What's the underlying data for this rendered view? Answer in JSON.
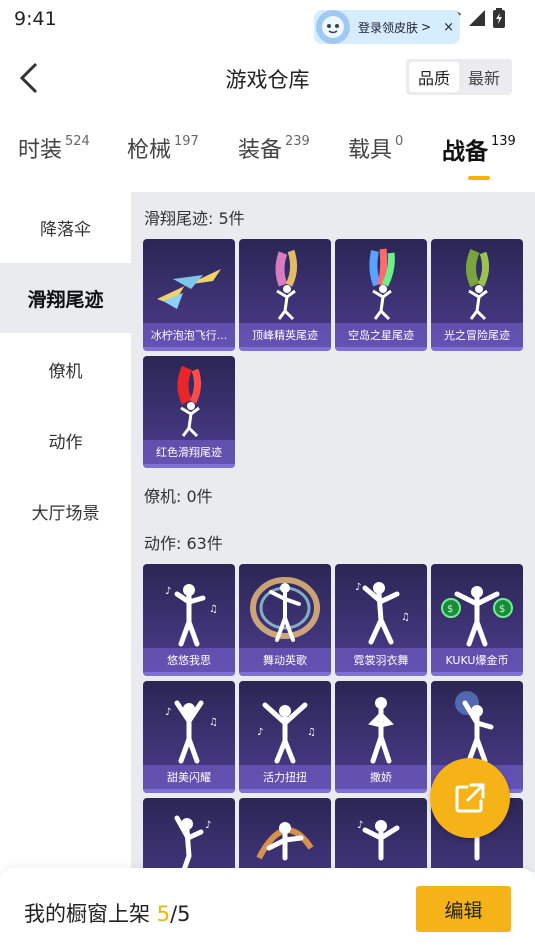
{
  "status": {
    "time": "9:41"
  },
  "promo": {
    "text": "登录领皮肤",
    "arrow": ">",
    "close": "×"
  },
  "header": {
    "title": "游戏仓库",
    "sort_quality": "品质",
    "sort_latest": "最新"
  },
  "tabs": [
    {
      "label": "时装",
      "count": "524"
    },
    {
      "label": "枪械",
      "count": "197"
    },
    {
      "label": "装备",
      "count": "239"
    },
    {
      "label": "载具",
      "count": "0"
    },
    {
      "label": "战备",
      "count": "139"
    }
  ],
  "sidebar": [
    {
      "label": "降落伞"
    },
    {
      "label": "滑翔尾迹"
    },
    {
      "label": "僚机"
    },
    {
      "label": "动作"
    },
    {
      "label": "大厅场景"
    }
  ],
  "sections": {
    "trails": {
      "title": "滑翔尾迹: 5件",
      "items": [
        {
          "label": "冰柠泡泡飞行..."
        },
        {
          "label": "顶峰精英尾迹"
        },
        {
          "label": "空岛之星尾迹"
        },
        {
          "label": "光之冒险尾迹"
        },
        {
          "label": "红色滑翔尾迹"
        }
      ]
    },
    "wingman": {
      "title": "僚机: 0件"
    },
    "actions": {
      "title": "动作: 63件",
      "items": [
        {
          "label": "悠悠我思"
        },
        {
          "label": "舞动英歌"
        },
        {
          "label": "霓裳羽衣舞"
        },
        {
          "label": "KUKU爆金币"
        },
        {
          "label": "甜美闪耀"
        },
        {
          "label": "活力扭扭"
        },
        {
          "label": "撒娇"
        },
        {
          "label": ""
        }
      ]
    }
  },
  "footer": {
    "text": "我的橱窗上架 ",
    "count": "5",
    "total": "/5",
    "edit": "编辑"
  },
  "colors": {
    "accent": "#f6b318",
    "card_top": "#2b2654",
    "card_bottom": "#4d3d8e",
    "sidebar_active": "#e9ebef"
  }
}
